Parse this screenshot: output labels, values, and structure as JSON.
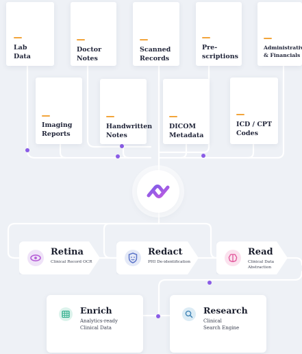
{
  "sources_top": [
    {
      "lines": [
        "Lab",
        "Data"
      ]
    },
    {
      "lines": [
        "Doctor",
        "Notes"
      ]
    },
    {
      "lines": [
        "Scanned",
        "Records"
      ]
    },
    {
      "lines": [
        "Pre-",
        "scriptions"
      ]
    },
    {
      "lines": [
        "Administrative",
        "& Financials"
      ]
    }
  ],
  "sources_bottom": [
    {
      "lines": [
        "Imaging",
        "Reports"
      ]
    },
    {
      "lines": [
        "Handwritten",
        "Notes"
      ]
    },
    {
      "lines": [
        "DICOM",
        "Metadata"
      ]
    },
    {
      "lines": [
        "ICD / CPT",
        "Codes"
      ]
    }
  ],
  "hub": {
    "icon": "infinity-link-logo-icon"
  },
  "processors": [
    {
      "title": "Retina",
      "sub": [
        "Clinical Record OCR"
      ],
      "icon": "eye-icon",
      "color": "#b55bd6",
      "bg": "#efe3f8"
    },
    {
      "title": "Redact",
      "sub": [
        "PHI De-identification"
      ],
      "icon": "shield-face-icon",
      "color": "#5b74c8",
      "bg": "#e4e9f7"
    },
    {
      "title": "Read",
      "sub": [
        "Clinical Data",
        "Abstraction"
      ],
      "icon": "brain-icon",
      "color": "#e2559a",
      "bg": "#fbe2ee"
    }
  ],
  "outputs": [
    {
      "title": "Enrich",
      "sub": [
        "Analytics-ready",
        "Clinical Data"
      ],
      "icon": "table-icon",
      "color": "#2fae8c",
      "bg": "#dcf3ec"
    },
    {
      "title": "Research",
      "sub": [
        "Clinical",
        "Search Engine"
      ],
      "icon": "search-icon",
      "color": "#3f83b5",
      "bg": "#dcecf5"
    }
  ],
  "colors": {
    "accent": "#9b5fe0",
    "line": "#ffffff",
    "dot": "#8a5ce6",
    "dash": "#f2a43a"
  }
}
